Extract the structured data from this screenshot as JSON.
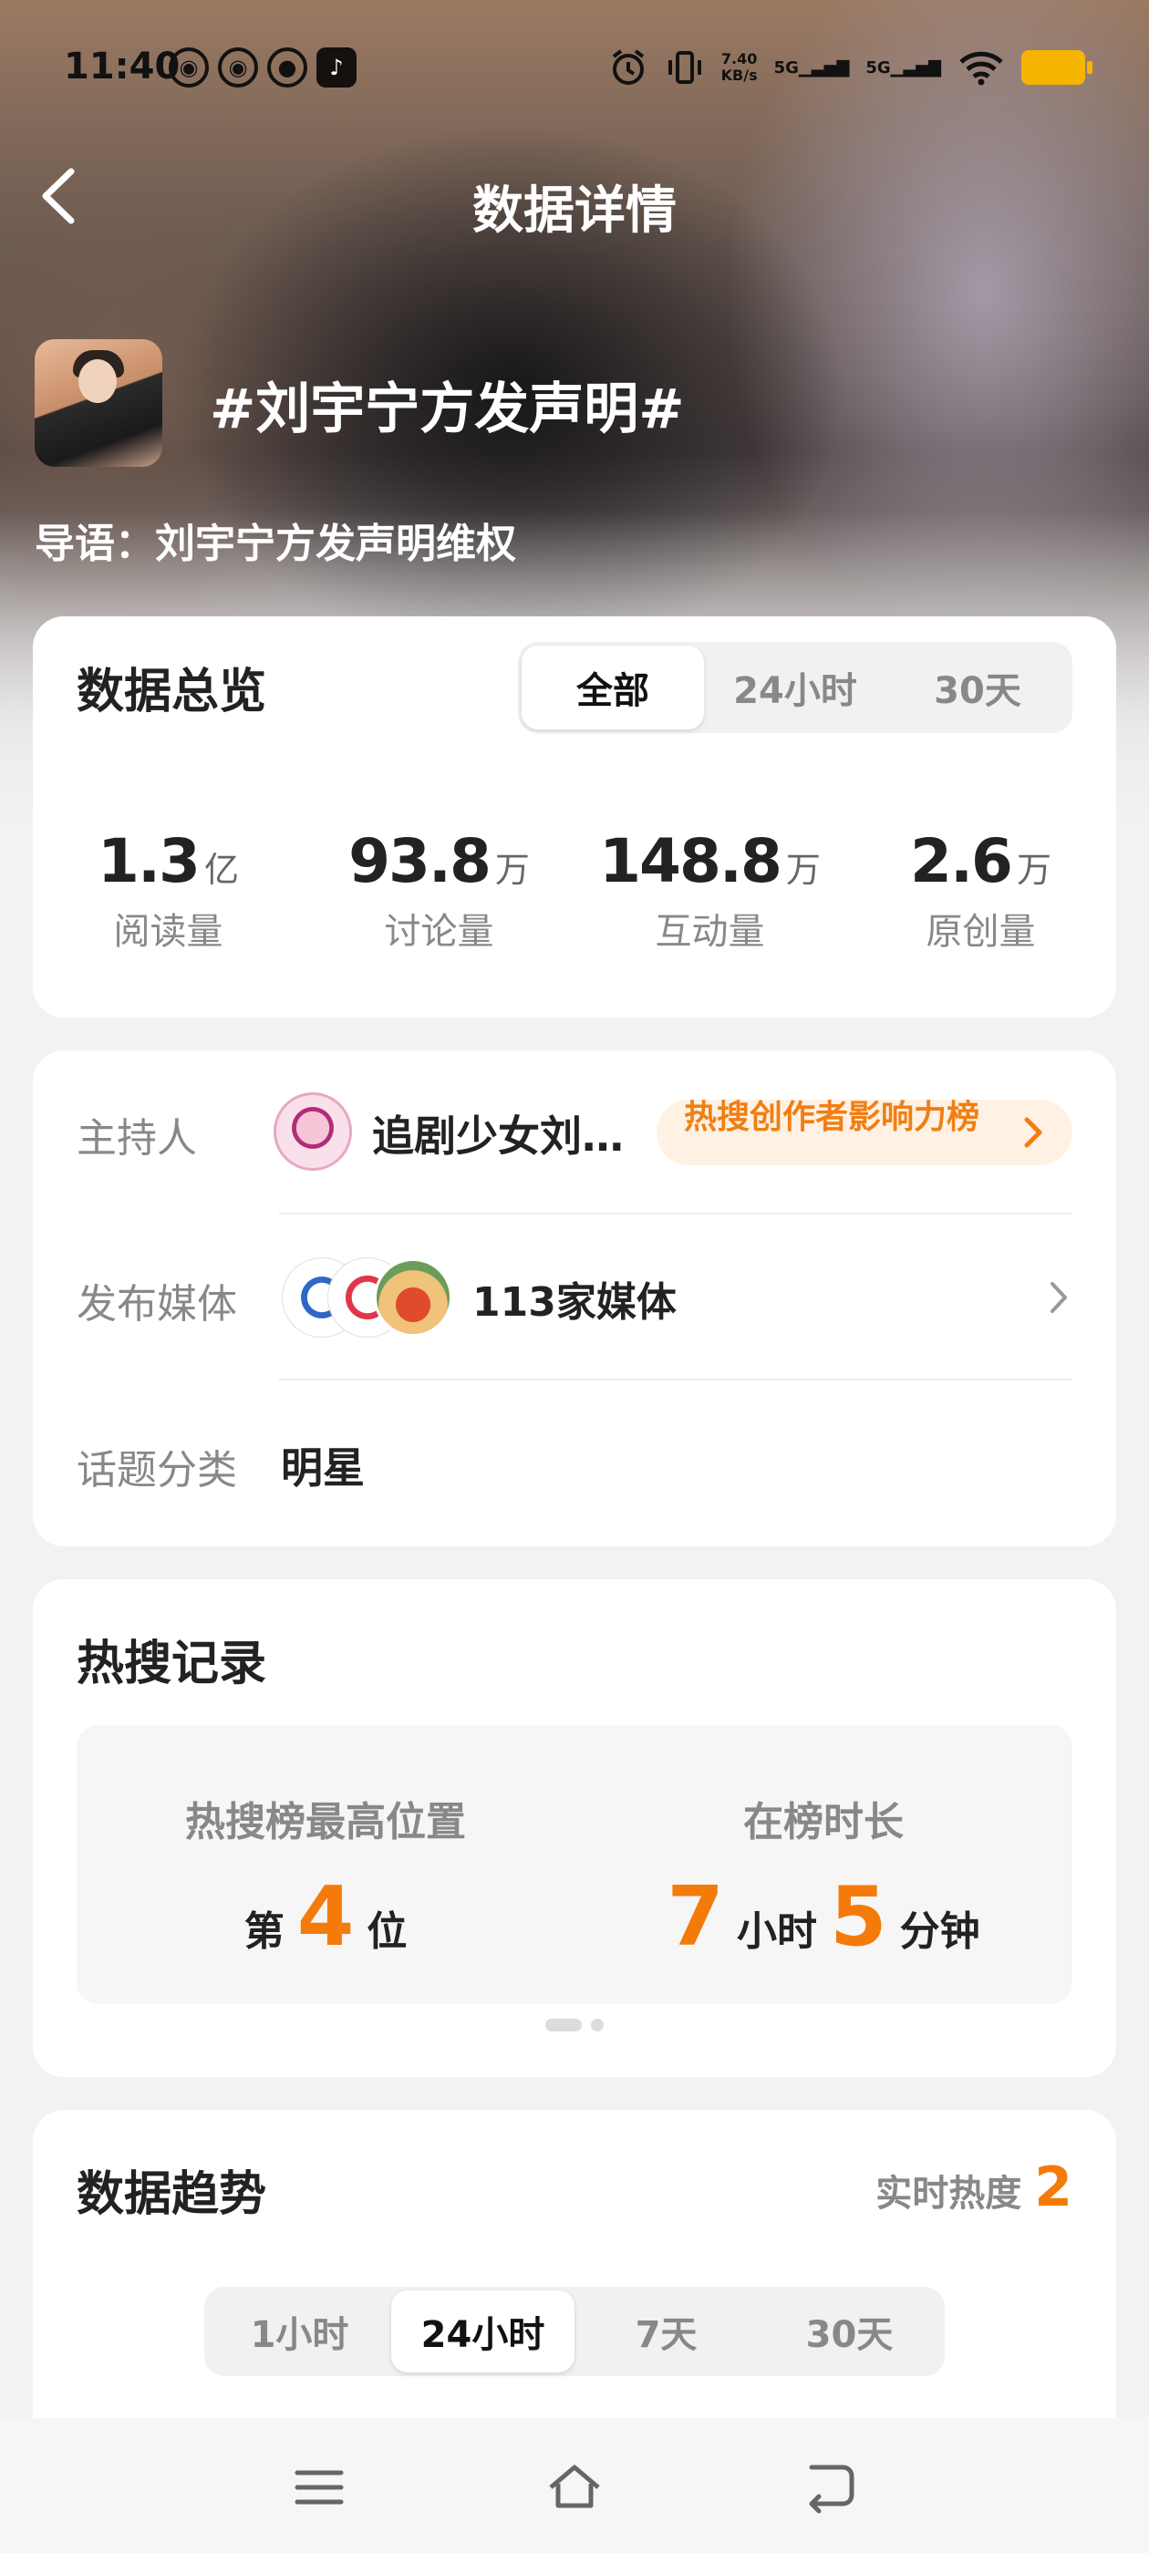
{
  "status_bar": {
    "time": "11:40",
    "left_icons": [
      "weibo-icon",
      "weibo-icon",
      "wechat-icon",
      "tiktok-icon"
    ],
    "net_speed": "7.40",
    "net_unit": "KB/s",
    "signal1": "5G",
    "signal2": "5G"
  },
  "header": {
    "title": "数据详情"
  },
  "topic": {
    "title": "#刘宇宁方发声明#",
    "intro": "导语：刘宇宁方发声明维权"
  },
  "overview": {
    "title": "数据总览",
    "tabs": [
      "全部",
      "24小时",
      "30天"
    ],
    "active_tab": 0,
    "stats": [
      {
        "value": "1.3",
        "unit": "亿",
        "label": "阅读量"
      },
      {
        "value": "93.8",
        "unit": "万",
        "label": "讨论量"
      },
      {
        "value": "148.8",
        "unit": "万",
        "label": "互动量"
      },
      {
        "value": "2.6",
        "unit": "万",
        "label": "原创量"
      }
    ]
  },
  "info": {
    "host_label": "主持人",
    "host_name": "追剧少女刘…",
    "rank_link": "热搜创作者影响力榜",
    "media_label": "发布媒体",
    "media_count": "113家媒体",
    "category_label": "话题分类",
    "category_value": "明星"
  },
  "hot_search": {
    "title": "热搜记录",
    "max_pos_label": "热搜榜最高位置",
    "max_pos_prefix": "第",
    "max_pos_value": "4",
    "max_pos_suffix": "位",
    "duration_label": "在榜时长",
    "hours": "7",
    "hours_unit": "小时",
    "minutes": "5",
    "minutes_unit": "分钟",
    "page_indicator": {
      "current": 1,
      "total": 2
    }
  },
  "trend": {
    "title": "数据趋势",
    "heat_label": "实时热度",
    "heat_value": "2",
    "tabs": [
      "1小时",
      "24小时",
      "7天",
      "30天"
    ],
    "active_tab": 1
  },
  "colors": {
    "accent": "#f47b0a",
    "pill_bg": "#fff1e4"
  },
  "nav": [
    "menu-icon",
    "home-icon",
    "back-icon"
  ]
}
